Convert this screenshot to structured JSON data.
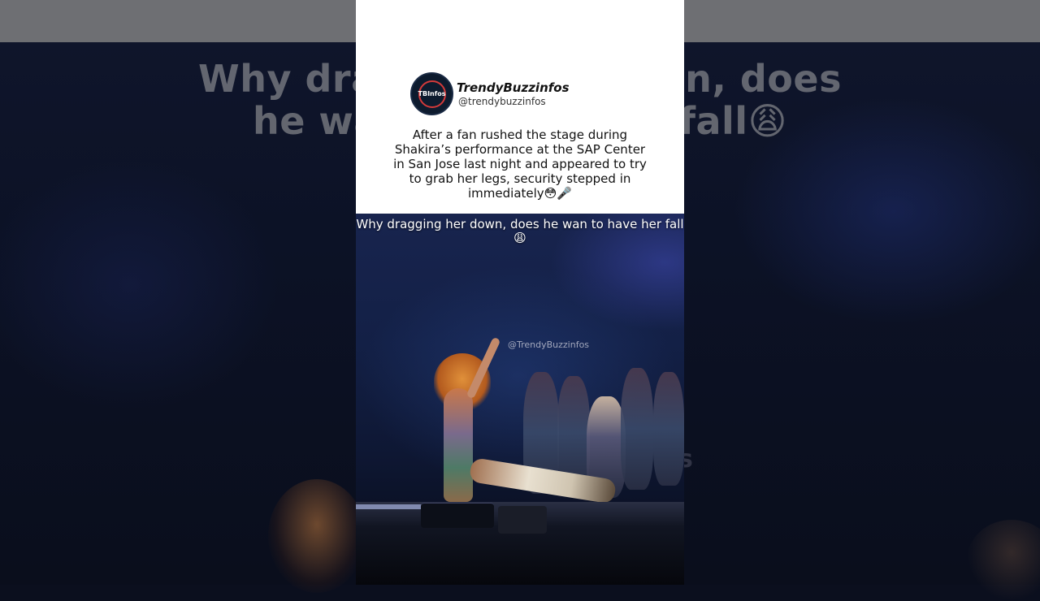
{
  "background": {
    "blurred_caption": "Why dragging her down, does he wan to have her fall😩",
    "blurred_watermark": "nfos"
  },
  "post": {
    "avatar_text": "TBInfos",
    "account_name": "TrendyBuzzinfos",
    "account_handle": "@trendybuzzinfos",
    "body": "After a fan rushed the stage during Shakira’s performance at the SAP Center in San Jose last night and appeared to try to grab her legs, security stepped in immediately😳🎤"
  },
  "video": {
    "caption": "Why dragging her down, does he wan to have her fall😩",
    "watermark": "@TrendyBuzzinfos"
  },
  "colors": {
    "card_background": "#ffffff",
    "avatar_ring": "#d43a3a",
    "stage_blue": "#18244e"
  }
}
